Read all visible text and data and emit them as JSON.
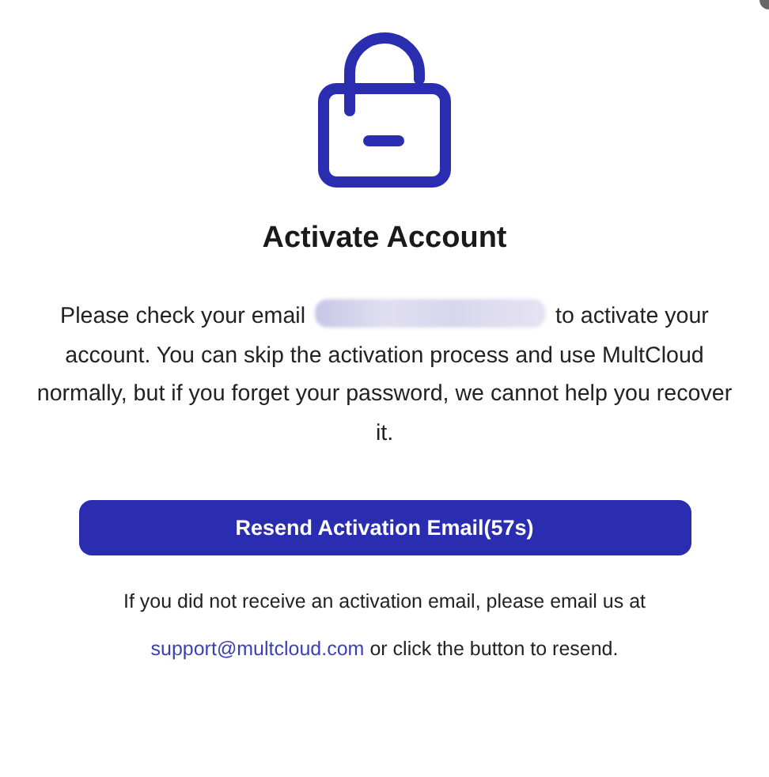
{
  "title": "Activate Account",
  "message": {
    "before": "Please check your email",
    "after": "to activate your account. You can skip the activation process and use MultCloud normally, but if you forget your password, we cannot help you recover it."
  },
  "button": {
    "label": "Resend Activation Email(57s)"
  },
  "help": {
    "line1": "If you did not receive an activation email, please email us at",
    "link": "support@multcloud.com",
    "after": "or click the button to resend."
  }
}
